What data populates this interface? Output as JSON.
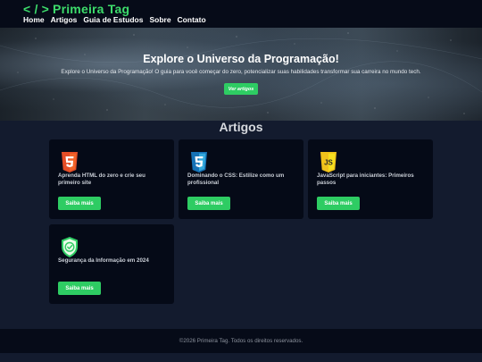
{
  "header": {
    "logo_tag": "< / >",
    "logo_text": "Primeira Tag",
    "nav": [
      "Home",
      "Artigos",
      "Guia de Estudos",
      "Sobre",
      "Contato"
    ]
  },
  "hero": {
    "title": "Explore o Universo da Programação!",
    "subtitle": "Explore o Universo da Programação! O guia para você começar do zero, potencializar suas habilidades transformar sua carreira no mundo tech.",
    "button": "Ver artigos"
  },
  "articles": {
    "heading": "Artigos",
    "items": [
      {
        "icon": "html5-icon",
        "title": "Aprenda HTML do zero e crie seu primeiro site",
        "button": "Saiba mais"
      },
      {
        "icon": "css3-icon",
        "title": "Dominando o CSS: Estilize como um profissional",
        "button": "Saiba mais"
      },
      {
        "icon": "javascript-icon",
        "title": "JavaScript para iniciantes: Primeiros passos",
        "button": "Saiba mais"
      },
      {
        "icon": "security-shield-icon",
        "title": "Segurança da Informação em 2024",
        "button": "Saiba mais"
      }
    ]
  },
  "footer": {
    "text": "©2026 Primeira Tag. Todos os direitos reservados."
  },
  "colors": {
    "accent": "#2ecc63",
    "header_bg": "#060b18",
    "page_bg": "#131b2e",
    "card_bg": "#050a17",
    "html5": "#e44d26",
    "css3": "#1572b6",
    "javascript": "#f0c21b"
  }
}
